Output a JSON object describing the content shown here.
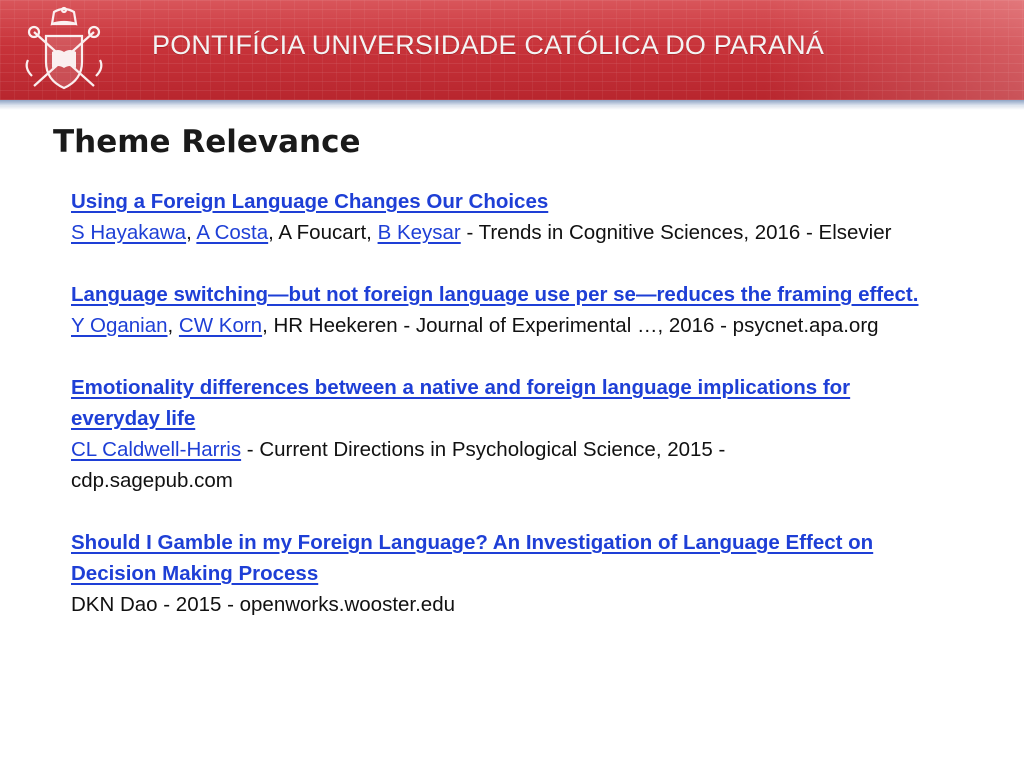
{
  "header": {
    "title": "PONTIFÍCIA UNIVERSIDADE CATÓLICA DO PARANÁ",
    "crest_icon": "pucpr-crest-icon",
    "banner_color": "#c8333a"
  },
  "page": {
    "title": "Theme Relevance"
  },
  "references": [
    {
      "title": "Using a Foreign Language Changes Our Choices",
      "linked_authors": [
        "S Hayakawa",
        "A Costa"
      ],
      "author_sep_1": ", ",
      "plain_author": "A Foucart",
      "linked_author_3": "B Keysar",
      "source": " - Trends in Cognitive Sciences, 2016 - Elsevier"
    },
    {
      "title": "Language switching—but not foreign language use per se—reduces the framing effect.",
      "linked_authors": [
        "Y Oganian",
        "CW Korn"
      ],
      "plain_author": "HR Heekeren",
      "source": " - Journal of Experimental …, 2016 - psycnet.apa.org"
    },
    {
      "title": "Emotionality differences between a native and foreign language implications for everyday life",
      "linked_authors": [
        "CL Caldwell-Harris"
      ],
      "source": " - Current Directions in Psychological Science, 2015 - cdp.sagepub.com"
    },
    {
      "title": "Should I Gamble in my Foreign Language? An Investigation of Language Effect on Decision Making Process",
      "source": "DKN Dao - 2015 - openworks.wooster.edu"
    }
  ],
  "colors": {
    "link": "#1e3fd6",
    "text": "#111111"
  }
}
